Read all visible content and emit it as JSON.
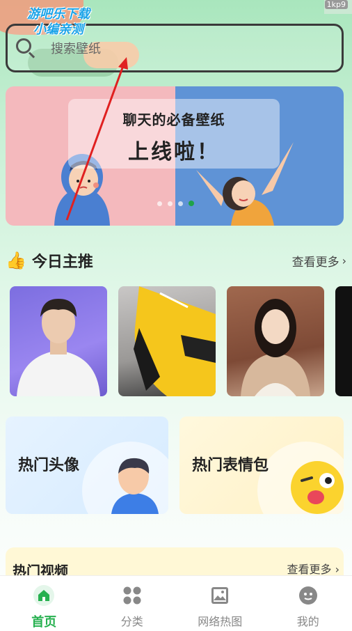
{
  "watermark": {
    "line1": "游吧乐下载",
    "line2": "小编亲测"
  },
  "status": {
    "version": "1kp9"
  },
  "search": {
    "placeholder": "搜索壁纸"
  },
  "banner": {
    "subtitle": "聊天的必备壁纸",
    "title": "上线啦！",
    "slide_count": 4,
    "active_slide": 4
  },
  "today": {
    "icon": "thumbs-up-icon",
    "title": "今日主推",
    "more_label": "查看更多"
  },
  "categories": [
    {
      "label": "热门头像",
      "icon": "avatar-illustration"
    },
    {
      "label": "热门表情包",
      "icon": "emoji-face-illustration"
    }
  ],
  "video": {
    "title": "热门视频",
    "more_label": "查看更多"
  },
  "tabs": [
    {
      "label": "首页",
      "icon": "home-icon",
      "active": true
    },
    {
      "label": "分类",
      "icon": "grid-icon",
      "active": false
    },
    {
      "label": "网络热图",
      "icon": "image-icon",
      "active": false
    },
    {
      "label": "我的",
      "icon": "profile-icon",
      "active": false
    }
  ],
  "colors": {
    "accent": "#26b04f",
    "search_border": "#3a3a3a",
    "annotation": "#e02020"
  }
}
